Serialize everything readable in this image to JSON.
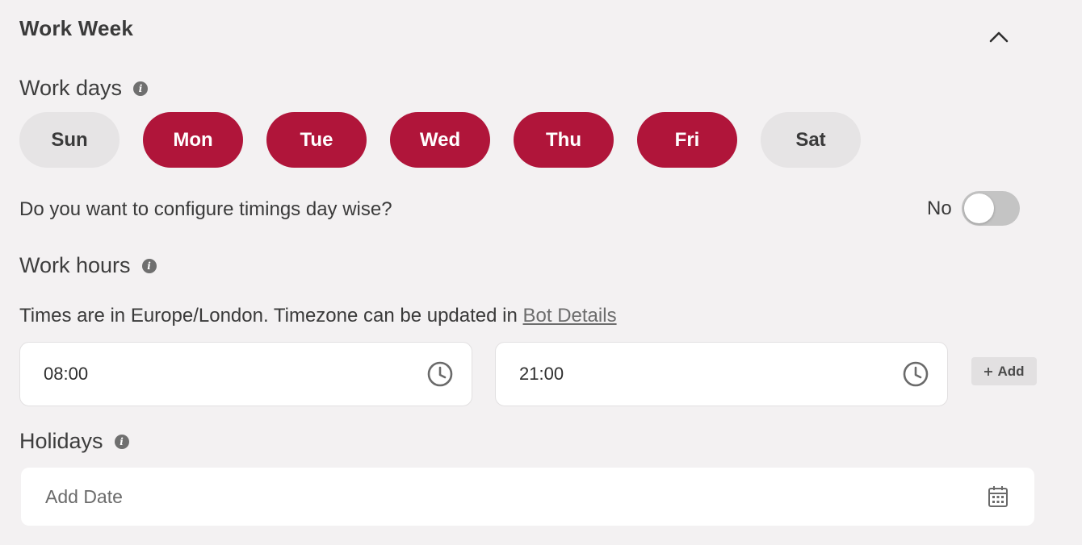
{
  "section": {
    "title": "Work Week"
  },
  "work_days": {
    "label": "Work days",
    "days": [
      {
        "label": "Sun",
        "active": false
      },
      {
        "label": "Mon",
        "active": true
      },
      {
        "label": "Tue",
        "active": true
      },
      {
        "label": "Wed",
        "active": true
      },
      {
        "label": "Thu",
        "active": true
      },
      {
        "label": "Fri",
        "active": true
      },
      {
        "label": "Sat",
        "active": false
      }
    ]
  },
  "day_wise": {
    "question": "Do you want to configure timings day wise?",
    "toggle_label": "No",
    "enabled": false
  },
  "work_hours": {
    "label": "Work hours",
    "tz_note_prefix": "Times are in Europe/London. Timezone can be updated in ",
    "tz_link": "Bot Details",
    "start_time": "08:00",
    "end_time": "21:00",
    "add_label": "Add"
  },
  "holidays": {
    "label": "Holidays",
    "placeholder": "Add Date"
  },
  "colors": {
    "accent": "#b0153a",
    "inactive_day": "#e6e4e5",
    "background": "#f3f1f2"
  },
  "icons": {
    "collapse": "chevron-up-icon",
    "info": "info-icon",
    "clock": "clock-icon",
    "calendar": "calendar-icon",
    "plus": "plus-icon"
  }
}
